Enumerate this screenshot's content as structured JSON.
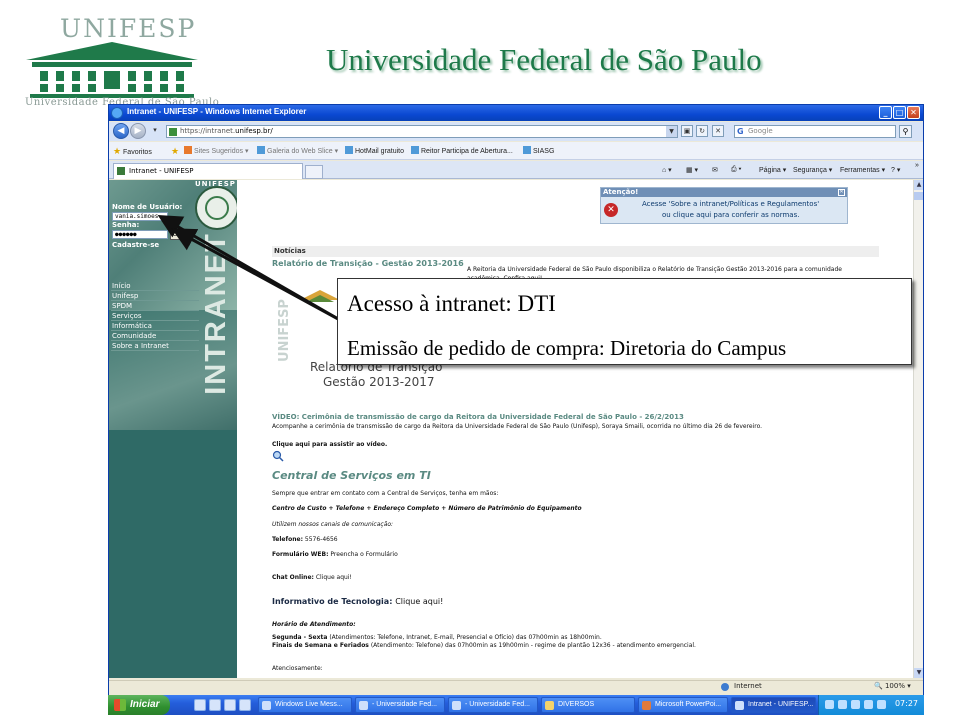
{
  "slide": {
    "title": "Universidade Federal de São Paulo",
    "logo_wordmark": "UNIFESP",
    "logo_subtext": "Universidade Federal de São Paulo"
  },
  "browser": {
    "window_title": "Intranet - UNIFESP - Windows Internet Explorer",
    "url_prefix": "https://intranet.",
    "url_host": "unifesp.br/",
    "search_placeholder": "Google",
    "favorites_label": "Favoritos",
    "favorites": [
      "Sites Sugeridos ▾",
      "Galeria do Web Slice ▾",
      "HotMail gratuito",
      "Reitor Participa de Abertura...",
      "SIASG"
    ],
    "tab_title": "Intranet - UNIFESP",
    "commands": [
      "Página ▾",
      "Segurança ▾",
      "Ferramentas ▾"
    ],
    "status_zone": "Internet",
    "zoom": "100%"
  },
  "sidebar": {
    "unifesp_mini": "UNIFESP",
    "username_label": "Nome de Usuário:",
    "username_value": "vania.simoes",
    "password_label": "Senha:",
    "password_value": "●●●●●●",
    "ok_label": "Ok",
    "register_label": "Cadastre-se",
    "intranet_word": "INTRANET",
    "menu": [
      "Início",
      "Unifesp",
      "SPDM",
      "Serviços",
      "Informática",
      "Comunidade",
      "Sobre a Intranet"
    ]
  },
  "notice": {
    "header": "Atenção!",
    "line1": "Acesse 'Sobre a intranet/Políticas e Regulamentos'",
    "line2": "ou clique aqui para conferir as normas."
  },
  "content": {
    "section_label": "Notícias",
    "relatorio_title": "Relatório de Transição - Gestão 2013-2016",
    "relatorio_text1": "A Reitoria da Universidade Federal de São Paulo disponibiliza o Relatório de Transição Gestão 2013-2016 para a comunidade",
    "relatorio_text2": "acadêmica. Confira aqui!",
    "graphic_unifesp": "UNIFESP",
    "graphic_line1": "Relatório de Transição",
    "graphic_line2": "Gestão 2013-2017",
    "video_title": "VÍDEO: Cerimônia de transmissão de cargo da Reitora da Universidade Federal de São Paulo - 26/2/2013",
    "video_text": "Acompanhe a cerimônia de transmissão de cargo da Reitora da Universidade Federal de São Paulo (Unifesp), Soraya Smaili, ocorrida no último dia 26 de fevereiro.",
    "video_link": "Clique aqui para assistir ao vídeo.",
    "central_title": "Central de Serviços em TI",
    "central_text": "Sempre que entrar em contato com a Central de Serviços, tenha em mãos:",
    "central_items": "Centro de Custo + Telefone + Endereço Completo + Número de Patrimônio do Equipamento",
    "channels": "Utilizem nossos canais de comunicação:",
    "telefone_label": "Telefone:",
    "telefone_value": "5576-4656",
    "formulario_label": "Formulário WEB:",
    "formulario_value": "Preencha o Formulário",
    "chat_label": "Chat Online:",
    "chat_value": "Clique aqui!",
    "informativo_label": "Informativo de Tecnologia:",
    "informativo_value": "Clique aqui!",
    "horario_label": "Horário de Atendimento:",
    "horario1_label": "Segunda - Sexta",
    "horario1_value": "(Atendimentos: Telefone, Intranet, E-mail, Presencial e Ofício) das 07h00min as 18h00min.",
    "horario2_label": "Finais de Semana e Feriados",
    "horario2_value": "(Atendimento: Telefone) das 07h00min as 19h00min - regime de plantão 12x36 - atendimento emergencial.",
    "atenciosamente": "Atenciosamente:"
  },
  "taskbar": {
    "start_label": "Iniciar",
    "buttons": [
      "Windows Live Mess...",
      "- Universidade Fed...",
      "- Universidade Fed...",
      "DIVERSOS",
      "Microsoft PowerPoi...",
      "Intranet - UNIFESP..."
    ],
    "clock": "07:27"
  },
  "callout": {
    "line1": "Acesso à intranet: DTI",
    "line2": "Emissão de pedido de compra: Diretoria do Campus"
  }
}
